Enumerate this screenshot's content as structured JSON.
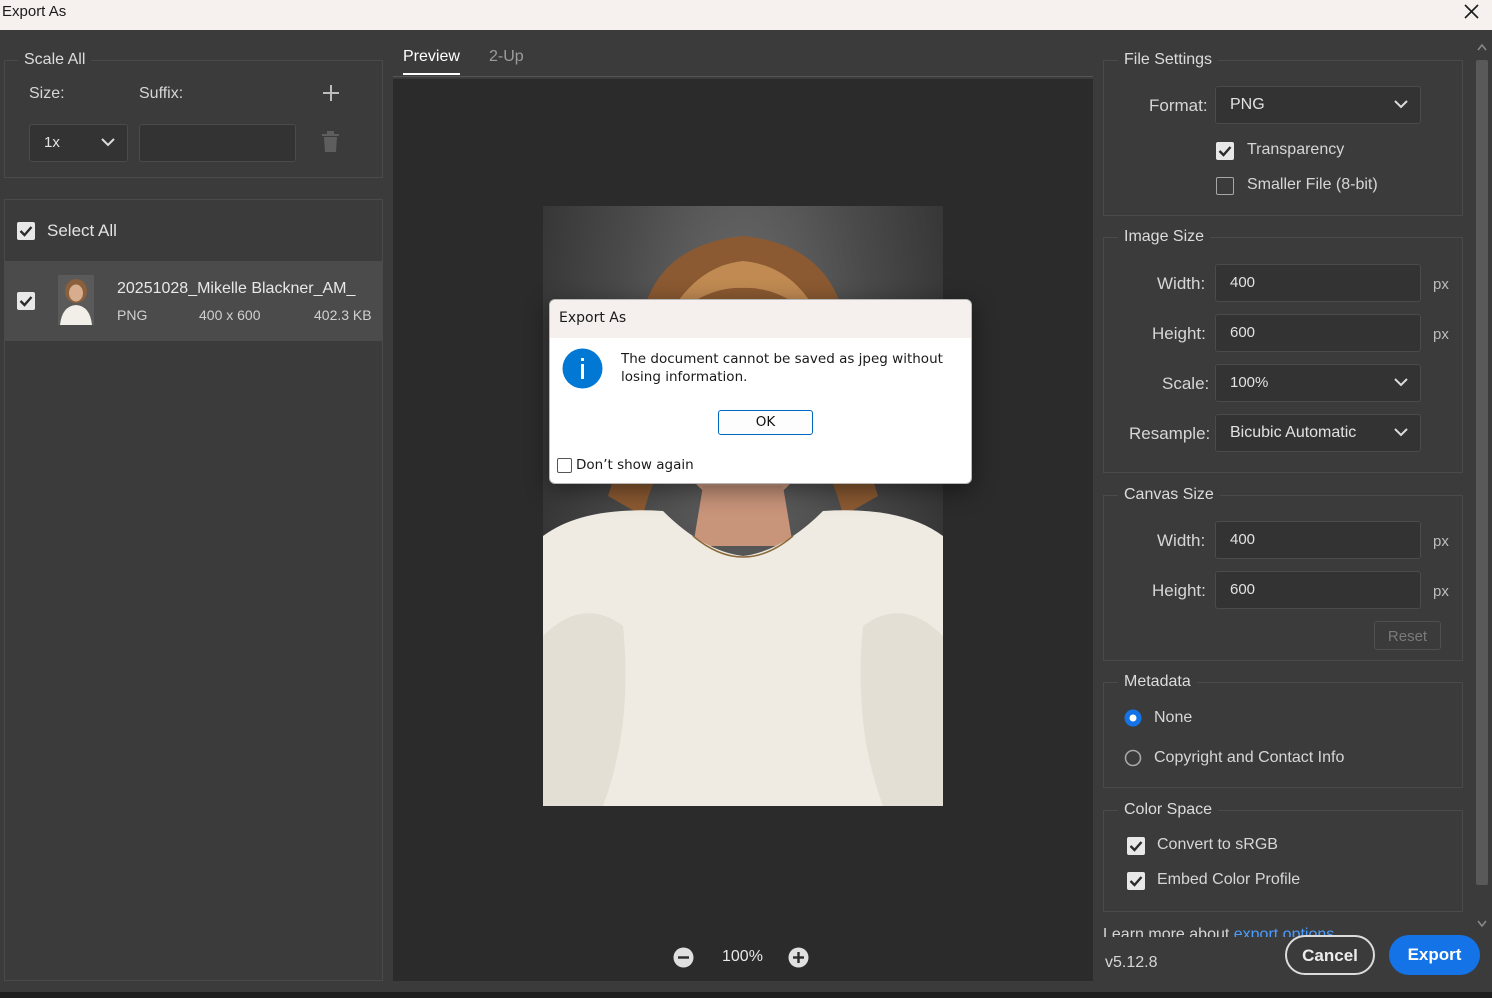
{
  "window": {
    "title": "Export As"
  },
  "scale_panel": {
    "title": "Scale All",
    "size_label": "Size:",
    "suffix_label": "Suffix:",
    "size_value": "1x",
    "suffix_value": ""
  },
  "files": {
    "select_all_label": "Select All",
    "items": [
      {
        "name": "20251028_Mikelle Blackner_AM_",
        "format": "PNG",
        "dimensions": "400 x 600",
        "size": "402.3 KB",
        "checked": true
      }
    ]
  },
  "tabs": [
    {
      "label": "Preview",
      "active": true
    },
    {
      "label": "2-Up",
      "active": false
    }
  ],
  "zoom": {
    "value": "100%"
  },
  "dialog": {
    "title": "Export As",
    "message": "The document cannot be saved as jpeg without losing information.",
    "ok_label": "OK",
    "checkbox_label": "Don’t show again"
  },
  "file_settings": {
    "title": "File Settings",
    "format_label": "Format:",
    "format_value": "PNG",
    "transparency_label": "Transparency",
    "transparency_checked": true,
    "smaller_file_label": "Smaller File (8-bit)",
    "smaller_file_checked": false
  },
  "image_size": {
    "title": "Image Size",
    "width_label": "Width:",
    "width_value": "400",
    "height_label": "Height:",
    "height_value": "600",
    "scale_label": "Scale:",
    "scale_value": "100%",
    "resample_label": "Resample:",
    "resample_value": "Bicubic Automatic",
    "unit": "px"
  },
  "canvas_size": {
    "title": "Canvas Size",
    "width_label": "Width:",
    "width_value": "400",
    "height_label": "Height:",
    "height_value": "600",
    "unit": "px",
    "reset_label": "Reset"
  },
  "metadata": {
    "title": "Metadata",
    "options": [
      {
        "label": "None",
        "selected": true
      },
      {
        "label": "Copyright and Contact Info",
        "selected": false
      }
    ]
  },
  "color_space": {
    "title": "Color Space",
    "convert_label": "Convert to sRGB",
    "embed_label": "Embed Color Profile"
  },
  "footer": {
    "learn_more_prefix": "Learn more about ",
    "learn_more_link": "export options",
    "version": "v5.12.8",
    "cancel_label": "Cancel",
    "export_label": "Export"
  },
  "colors": {
    "accent": "#1473e6",
    "panel_bg": "#3b3b3b",
    "preview_bg": "#2b2b2b",
    "dialog_info": "#0078d4"
  }
}
